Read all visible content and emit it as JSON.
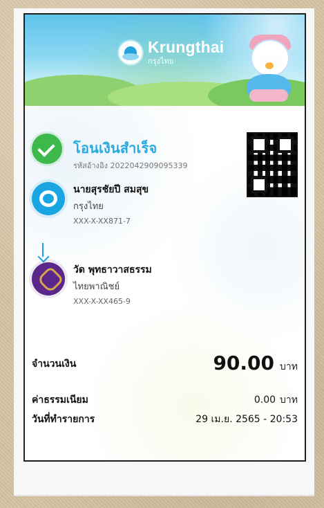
{
  "header": {
    "bank_name": "Krungthai",
    "bank_sub": "กรุงไทย"
  },
  "status": {
    "title": "โอนเงินสำเร็จ",
    "reference": "รหัสอ้างอิง 2022042909095339"
  },
  "sender": {
    "name": "นายสุรชัยปี สมสุข",
    "bank": "กรุงไทย",
    "account": "XXX-X-XX871-7"
  },
  "receiver": {
    "name": "วัด พุทธาวาสธรรม",
    "bank": "ไทยพาณิชย์",
    "account": "XXX-X-XX465-9"
  },
  "summary": {
    "amount_label": "จำนวนเงิน",
    "amount_value": "90.00",
    "amount_unit": "บาท",
    "fee_label": "ค่าธรรมเนียม",
    "fee_value": "0.00",
    "fee_unit": "บาท",
    "date_label": "วันที่ทำรายการ",
    "date_value": "29 เม.ย. 2565 - 20:53"
  },
  "icons": {
    "success": "check-circle-icon",
    "sender_bank": "krungthai-logo-icon",
    "receiver_bank": "scb-logo-icon",
    "arrow": "down-arrow-icon",
    "qr": "qr-code-icon"
  },
  "colors": {
    "success_green": "#3db84a",
    "brand_blue": "#26a9e0",
    "receiver_purple": "#5a268a"
  }
}
